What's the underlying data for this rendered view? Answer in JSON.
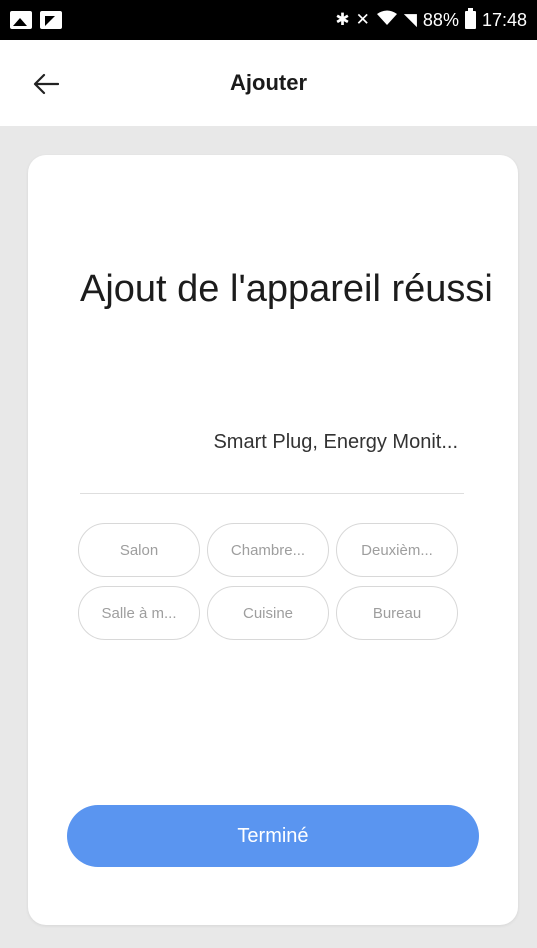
{
  "status_bar": {
    "icons_left": [
      "gallery-icon",
      "flipboard-icon"
    ],
    "bluetooth": "✱",
    "mute": "✕",
    "signal": "◥",
    "battery_percent": "88%",
    "time": "17:48"
  },
  "app_bar": {
    "title": "Ajouter",
    "back_icon": "arrow-left-icon"
  },
  "card": {
    "heading": "Ajout de l'appareil réussi",
    "device_name": "Smart Plug, Energy Monit...",
    "rooms": [
      {
        "label": "Salon"
      },
      {
        "label": "Chambre..."
      },
      {
        "label": "Deuxièm..."
      },
      {
        "label": "Salle à m..."
      },
      {
        "label": "Cuisine"
      },
      {
        "label": "Bureau"
      }
    ],
    "done_label": "Terminé"
  },
  "colors": {
    "accent": "#5a95f0",
    "background": "#e8e8e8",
    "card": "#ffffff",
    "chip_border": "#d8d8d8",
    "chip_text": "#9e9e9e"
  }
}
